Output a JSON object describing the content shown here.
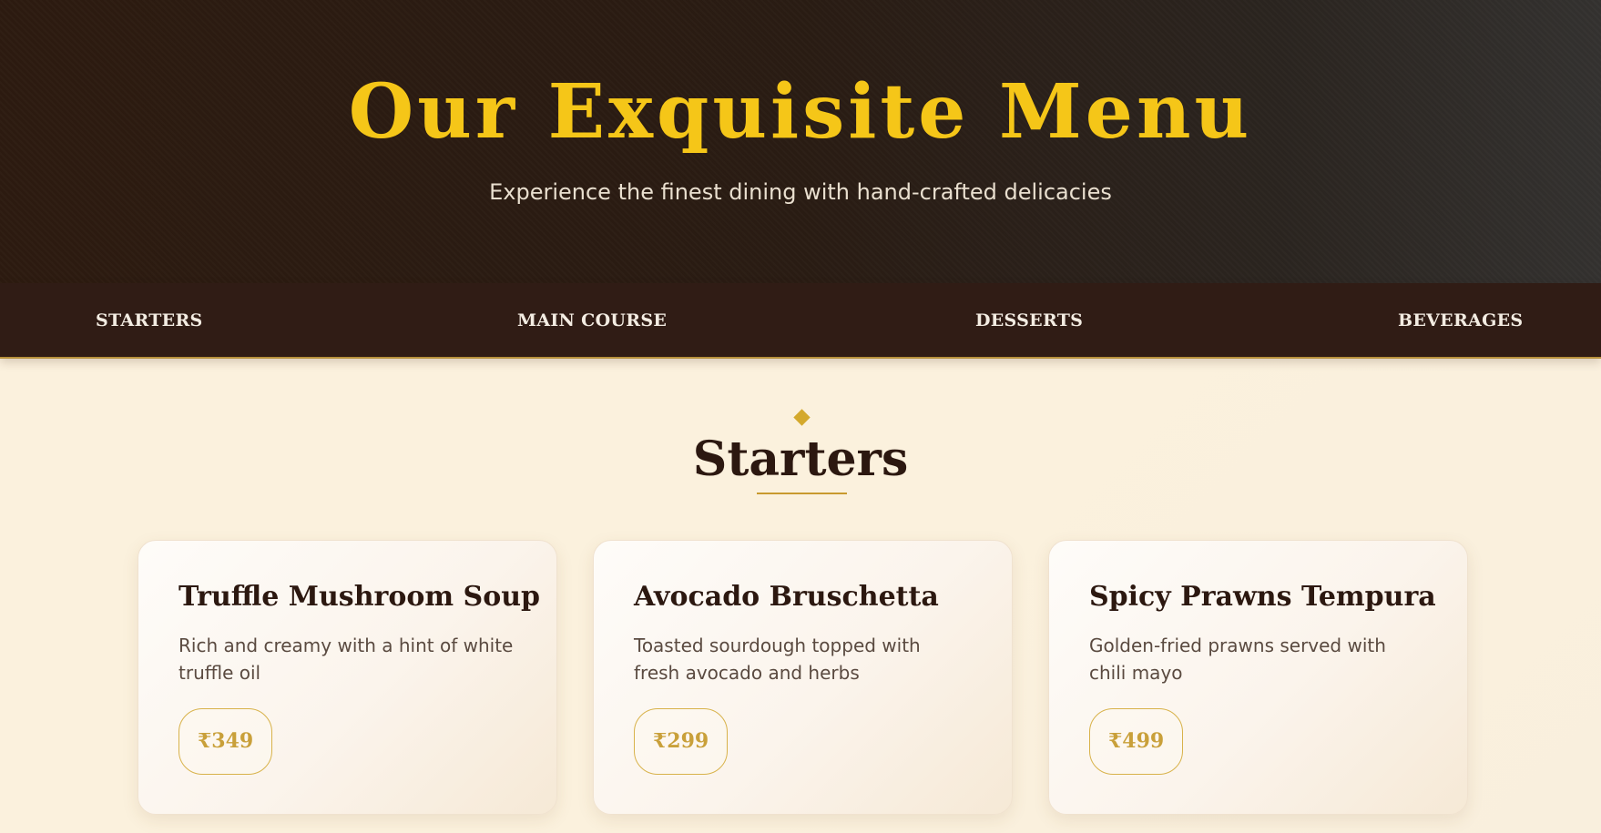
{
  "hero": {
    "title": "Our Exquisite Menu",
    "subtitle": "Experience the finest dining with hand-crafted delicacies"
  },
  "nav": {
    "items": [
      {
        "label": "STARTERS"
      },
      {
        "label": "MAIN COURSE"
      },
      {
        "label": "DESSERTS"
      },
      {
        "label": "BEVERAGES"
      }
    ]
  },
  "section": {
    "title": "Starters",
    "ornament_icon": "diamond-icon"
  },
  "cards": [
    {
      "name": "Truffle Mushroom Soup",
      "description": "Rich and creamy with a hint of white truffle oil",
      "price": "₹349"
    },
    {
      "name": "Avocado Bruschetta",
      "description": "Toasted sourdough topped with fresh avocado and herbs",
      "price": "₹299"
    },
    {
      "name": "Spicy Prawns Tempura",
      "description": "Golden-fried prawns served with chili mayo",
      "price": "₹499"
    }
  ],
  "colors": {
    "gold": "#f5c618",
    "accent": "#d4a92c",
    "dark_brown": "#301c15",
    "cream": "#fbf1dd"
  }
}
